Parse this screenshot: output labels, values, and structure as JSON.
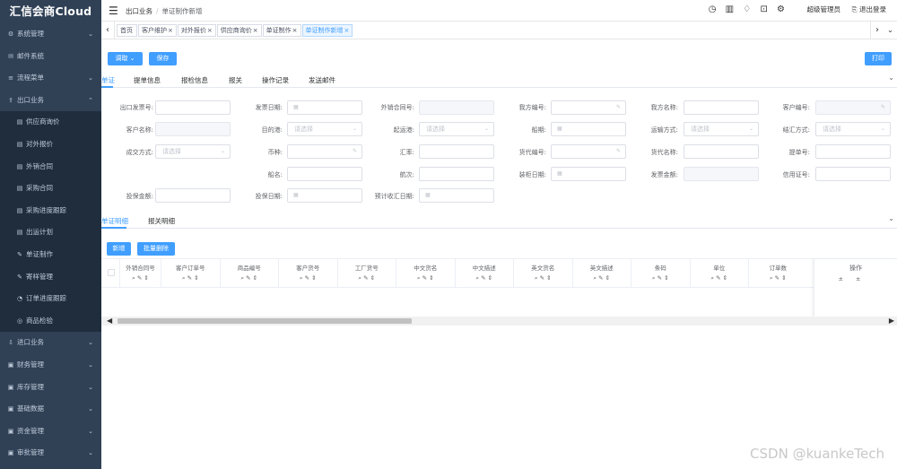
{
  "app": {
    "logo": "汇信会商Cloud"
  },
  "sidebar": {
    "items": [
      {
        "icon": "⚙",
        "label": "系统管理",
        "arrow": "⌄"
      },
      {
        "icon": "✉",
        "label": "邮件系统",
        "arrow": ""
      },
      {
        "icon": "≡",
        "label": "流程菜单",
        "arrow": "⌄"
      },
      {
        "icon": "⇪",
        "label": "出口业务",
        "arrow": "⌃"
      }
    ],
    "subitems": [
      {
        "icon": "▤",
        "label": "供应商询价"
      },
      {
        "icon": "▤",
        "label": "对外报价"
      },
      {
        "icon": "▤",
        "label": "外销合同"
      },
      {
        "icon": "▤",
        "label": "采购合同"
      },
      {
        "icon": "▤",
        "label": "采购进度跟踪"
      },
      {
        "icon": "▤",
        "label": "出运计划"
      },
      {
        "icon": "✎",
        "label": "单证制作"
      },
      {
        "icon": "✎",
        "label": "寄样管理"
      },
      {
        "icon": "◔",
        "label": "订单进度跟踪"
      },
      {
        "icon": "◎",
        "label": "商品检验"
      }
    ],
    "items_bottom": [
      {
        "icon": "⇩",
        "label": "进口业务",
        "arrow": "⌄"
      },
      {
        "icon": "▣",
        "label": "财务管理",
        "arrow": "⌄"
      },
      {
        "icon": "▣",
        "label": "库存管理",
        "arrow": "⌄"
      },
      {
        "icon": "▣",
        "label": "基础数据",
        "arrow": "⌄"
      },
      {
        "icon": "▣",
        "label": "资金管理",
        "arrow": "⌄"
      },
      {
        "icon": "▣",
        "label": "审批管理",
        "arrow": "⌄"
      }
    ]
  },
  "topbar": {
    "breadcrumb": [
      "出口业务",
      "单证制作新增"
    ],
    "user": "超级管理员",
    "logout": "退出登录"
  },
  "tags": [
    {
      "label": "首页",
      "close": ""
    },
    {
      "label": "客户维护",
      "close": "×"
    },
    {
      "label": "对外报价",
      "close": "×"
    },
    {
      "label": "供应商询价",
      "close": "×"
    },
    {
      "label": "单证制作",
      "close": "×"
    },
    {
      "label": "单证制作新增",
      "close": "×"
    }
  ],
  "toolbar": {
    "fetch": "调取 ⌄",
    "save": "保存",
    "print": "打印"
  },
  "tabs": [
    "单证",
    "提单信息",
    "报检信息",
    "报关",
    "操作记录",
    "发送邮件"
  ],
  "form": {
    "placeholder_select": "请选择",
    "labels": {
      "invoice_no": "出口发票号:",
      "invoice_date": "发票日期:",
      "sales_contract": "外销合同号:",
      "our_no": "我方编号:",
      "our_name": "我方名称:",
      "customer_no": "客户编号:",
      "customer_name": "客户名称:",
      "destination": "目的港:",
      "load_port": "起运港:",
      "vessel_date": "船期:",
      "transport": "运输方式:",
      "settlement": "结汇方式:",
      "trade_terms": "成交方式:",
      "currency": "币种:",
      "exchange_rate": "汇率:",
      "forwarder_no": "货代编号:",
      "forwarder_name": "货代名称:",
      "bl_no": "提单号:",
      "vessel_name": "船名:",
      "voyage": "航次:",
      "loading_date": "装柜日期:",
      "invoice_amount": "发票金额:",
      "lc_no": "信用证号:",
      "insured_amount": "投保金额:",
      "insure_date": "投保日期:",
      "expected_fx_date": "预计收汇日期:"
    }
  },
  "subtabs": [
    "单证明细",
    "报关明细"
  ],
  "detail_buttons": {
    "add": "新增",
    "batch_delete": "批量删除"
  },
  "grid": {
    "columns": [
      "外销合同号",
      "客户订单号",
      "商品编号",
      "客户货号",
      "工厂货号",
      "中文货名",
      "中文描述",
      "英文货名",
      "英文描述",
      "条码",
      "单位",
      "订单数"
    ],
    "tools": "⌕ ✎ ⇕",
    "op_header": "操作",
    "op_tools": "±±"
  },
  "watermark": "CSDN @kuankeTech"
}
